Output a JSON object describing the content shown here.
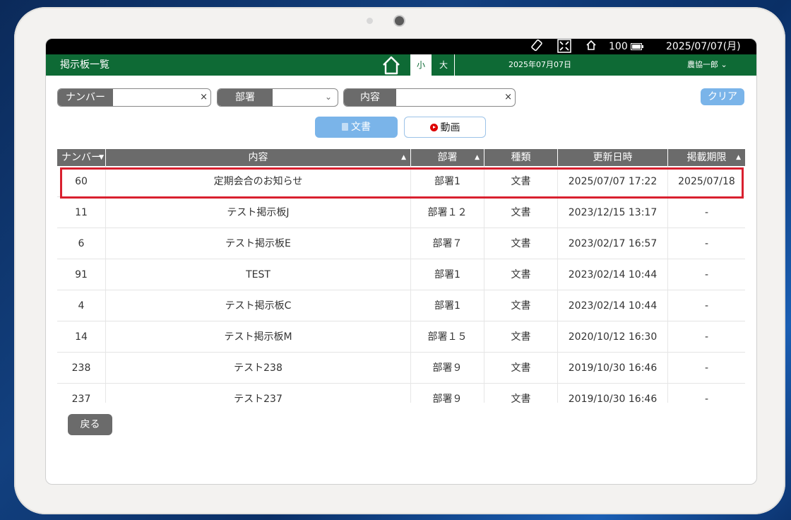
{
  "status_bar": {
    "battery": "100",
    "datetime": "2025/07/07(月)"
  },
  "header": {
    "title": "掲示板一覧",
    "size_small": "小",
    "size_large": "大",
    "date": "2025年07月07日",
    "user": "農協一郎 ⌄"
  },
  "filters": {
    "number_label": "ナンバー",
    "number_value": "",
    "department_label": "部署",
    "department_value": "",
    "content_label": "内容",
    "content_value": "",
    "clear_mark": "×",
    "clear_button": "クリア"
  },
  "tabs": {
    "document": "文書",
    "video": "動画"
  },
  "table": {
    "headers": [
      "ナンバー",
      "内容",
      "部署",
      "種類",
      "更新日時",
      "掲載期限"
    ],
    "rows": [
      [
        "60",
        "定期会合のお知らせ",
        "部署1",
        "文書",
        "2025/07/07 17:22",
        "2025/07/18"
      ],
      [
        "11",
        "テスト掲示板J",
        "部署１２",
        "文書",
        "2023/12/15 13:17",
        "-"
      ],
      [
        "6",
        "テスト掲示板E",
        "部署７",
        "文書",
        "2023/02/17 16:57",
        "-"
      ],
      [
        "91",
        "TEST",
        "部署1",
        "文書",
        "2023/02/14 10:44",
        "-"
      ],
      [
        "4",
        "テスト掲示板C",
        "部署1",
        "文書",
        "2023/02/14 10:44",
        "-"
      ],
      [
        "14",
        "テスト掲示板M",
        "部署１５",
        "文書",
        "2020/10/12 16:30",
        "-"
      ],
      [
        "238",
        "テスト238",
        "部署９",
        "文書",
        "2019/10/30 16:46",
        "-"
      ],
      [
        "237",
        "テスト237",
        "部署９",
        "文書",
        "2019/10/30 16:46",
        "-"
      ]
    ]
  },
  "back_button": "戻る",
  "colors": {
    "header_green": "#0e6a35",
    "accent_blue": "#7ab4e9",
    "highlight_red": "#d9202f",
    "header_gray": "#6b6b6b"
  }
}
